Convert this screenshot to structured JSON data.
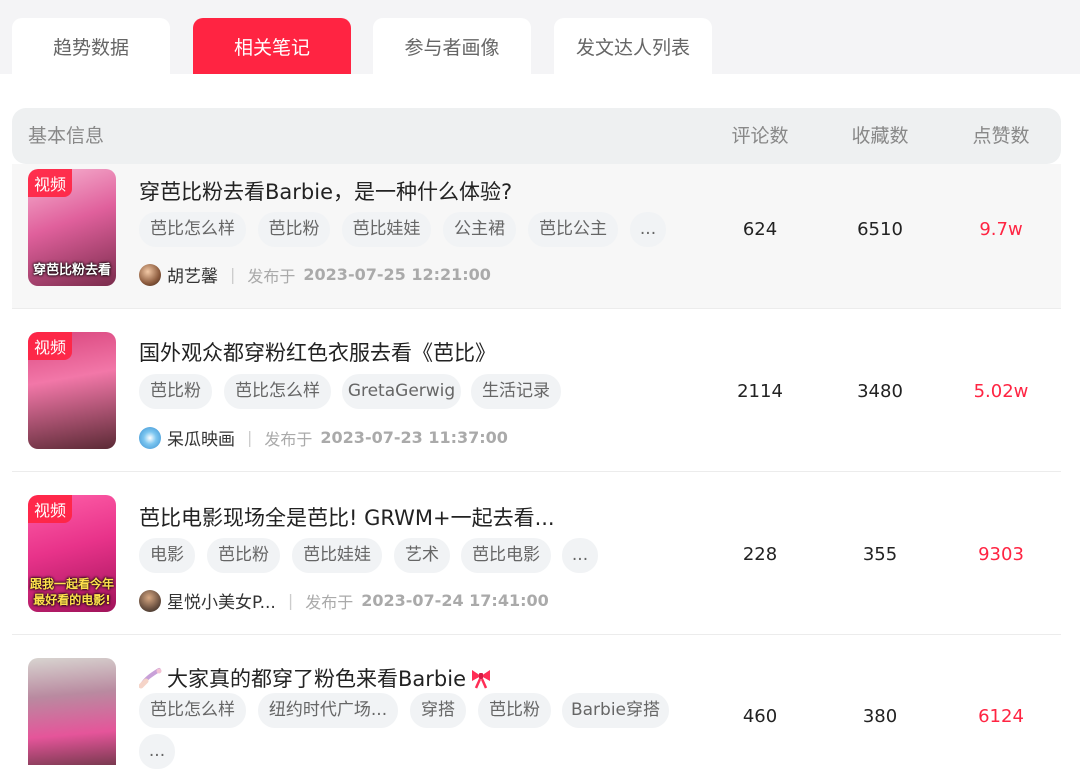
{
  "tabs": [
    "趋势数据",
    "相关笔记",
    "参与者画像",
    "发文达人列表"
  ],
  "active_tab": 1,
  "table_header": {
    "info": "基本信息",
    "comments": "评论数",
    "favorites": "收藏数",
    "likes": "点赞数"
  },
  "notes": [
    {
      "badge": "视频",
      "thumb_text": "穿芭比粉去看",
      "title": "穿芭比粉去看Barbie，是一种什么体验?",
      "tags": [
        "芭比怎么样",
        "芭比粉",
        "芭比娃娃",
        "公主裙",
        "芭比公主",
        "..."
      ],
      "author": "胡艺馨",
      "posted_prefix": "发布于",
      "date": "2023-07-25 12:21:00",
      "comments": "624",
      "favorites": "6510",
      "likes": "9.7w"
    },
    {
      "badge": "视频",
      "title": "国外观众都穿粉红色衣服去看《芭比》",
      "tags": [
        "芭比粉",
        "芭比怎么样",
        "GretaGerwig",
        "生活记录"
      ],
      "author": "呆瓜映画",
      "posted_prefix": "发布于",
      "date": "2023-07-23 11:37:00",
      "comments": "2114",
      "favorites": "3480",
      "likes": "5.02w"
    },
    {
      "badge": "视频",
      "thumb_text": "跟我一起看今年最好看的电影!",
      "title": "芭比电影现场全是芭比! GRWM+一起去看...",
      "tags": [
        "电影",
        "芭比粉",
        "芭比娃娃",
        "艺术",
        "芭比电影",
        "..."
      ],
      "author": "星悦小美女P...",
      "posted_prefix": "发布于",
      "date": "2023-07-24 17:41:00",
      "comments": "228",
      "favorites": "355",
      "likes": "9303"
    },
    {
      "title": "大家真的都穿了粉色来看Barbie",
      "tags": [
        "芭比怎么样",
        "纽约时代广场...",
        "穿搭",
        "芭比粉",
        "Barbie穿搭",
        "..."
      ],
      "comments": "460",
      "favorites": "380",
      "likes": "6124"
    }
  ],
  "colors": {
    "accent": "#ff2442",
    "header_bg": "#eef0f1",
    "tag_bg": "#f1f3f5"
  },
  "icons": {
    "title_prefix_icon": "nail-polish-icon",
    "title_suffix_icon": "ribbon-bow-icon"
  }
}
